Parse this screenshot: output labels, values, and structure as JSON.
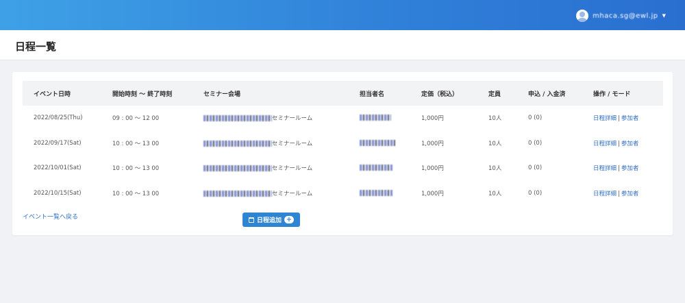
{
  "header": {
    "user_name": "mhaca.sg@ewl.jp",
    "user_caret": "▼"
  },
  "page": {
    "title": "日程一覧"
  },
  "table": {
    "columns": [
      "イベント日時",
      "開始時刻 ～ 終了時刻",
      "セミナー会場",
      "担当者名",
      "定価（税込）",
      "定員",
      "申込 / 入金済",
      "操作 / モード"
    ],
    "rows": [
      {
        "date": "2022/08/25(Thu)",
        "time": "09 : 00 ～ 12 00",
        "venue_suffix": "セミナールーム",
        "price": "1,000円",
        "capacity": "10人",
        "applied": "0 (0)",
        "detail": "日程詳細",
        "participants": "参加者"
      },
      {
        "date": "2022/09/17(Sat)",
        "time": "10 : 00 ～ 13 00",
        "venue_suffix": "セミナールーム",
        "price": "1,000円",
        "capacity": "10人",
        "applied": "0 (0)",
        "detail": "日程詳細",
        "participants": "参加者"
      },
      {
        "date": "2022/10/01(Sat)",
        "time": "10 : 00 ～ 13 00",
        "venue_suffix": "セミナールーム",
        "price": "1,000円",
        "capacity": "10人",
        "applied": "0 (0)",
        "detail": "日程詳細",
        "participants": "参加者"
      },
      {
        "date": "2022/10/15(Sat)",
        "time": "10 : 00 ～ 13 00",
        "venue_suffix": "セミナールーム",
        "price": "1,000円",
        "capacity": "10人",
        "applied": "0 (0)",
        "detail": "日程詳細",
        "participants": "参加者"
      }
    ],
    "separator": "|"
  },
  "actions": {
    "back_label": "イベント一覧へ戻る",
    "add_label": "日程追加",
    "add_plus": "+"
  },
  "colors": {
    "header_gradient_start": "#3ea1e6",
    "header_gradient_end": "#2a6fd0",
    "link": "#2f6fc7",
    "button": "#2e86d3"
  },
  "icons": [
    "user-avatar-icon",
    "calendar-icon",
    "plus-icon"
  ]
}
